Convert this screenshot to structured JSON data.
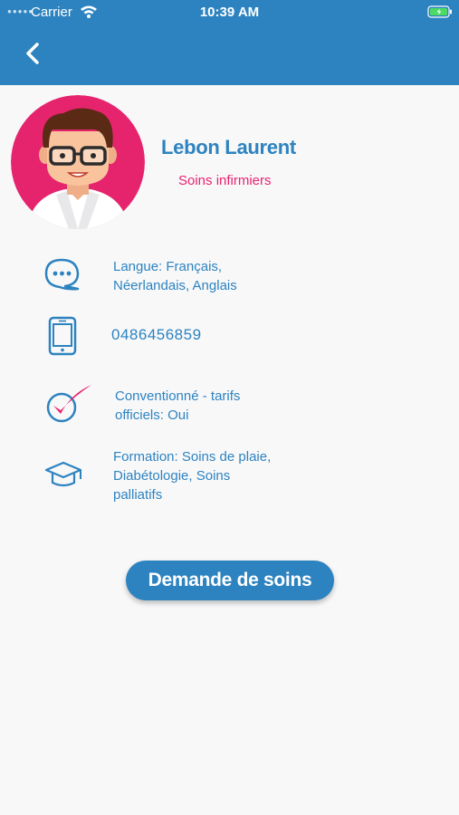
{
  "status_bar": {
    "carrier": "Carrier",
    "time": "10:39 AM"
  },
  "header": {
    "back_icon": "chevron-left-icon"
  },
  "profile": {
    "name": "Lebon Laurent",
    "specialty": "Soins infirmiers",
    "avatar_icon": "nurse-avatar"
  },
  "info": [
    {
      "icon": "chat-bubble-icon",
      "line1": "Langue: Français,",
      "line2": "Néerlandais, Anglais",
      "line3": ""
    },
    {
      "icon": "mobile-phone-icon",
      "line1": "0486456859",
      "line2": "",
      "line3": ""
    },
    {
      "icon": "checkmark-circle-icon",
      "line1": "Conventionné - tarifs",
      "line2": "officiels: Oui",
      "line3": ""
    },
    {
      "icon": "graduation-cap-icon",
      "line1": "Formation: Soins de plaie,",
      "line2": "Diabétologie, Soins",
      "line3": "palliatifs"
    }
  ],
  "actions": {
    "request_button": "Demande de soins"
  },
  "colors": {
    "primary": "#2d83c0",
    "accent": "#e8246f",
    "background": "#f8f8f9"
  }
}
